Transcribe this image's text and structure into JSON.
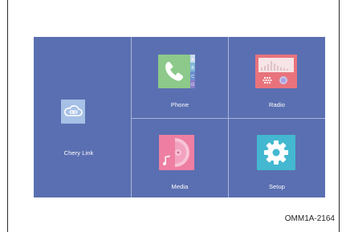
{
  "tiles": {
    "chery_link": {
      "label": "Chery Link",
      "icon": "cloud-link-icon"
    },
    "phone": {
      "label": "Phone",
      "icon": "phone-icon",
      "side_letters": [
        "A",
        "B",
        "C",
        "D"
      ]
    },
    "radio": {
      "label": "Radio",
      "icon": "radio-icon"
    },
    "media": {
      "label": "Media",
      "icon": "music-disc-icon"
    },
    "setup": {
      "label": "Setup",
      "icon": "gear-icon"
    }
  },
  "caption": "OMM1A-2164",
  "colors": {
    "screen_bg": "#5a6fb1",
    "phone_green": "#8cc98a",
    "radio_red": "#e8737c",
    "media_pink": "#ee7fa3",
    "setup_teal": "#43b8d0",
    "link_blue": "#a6c0e6"
  }
}
